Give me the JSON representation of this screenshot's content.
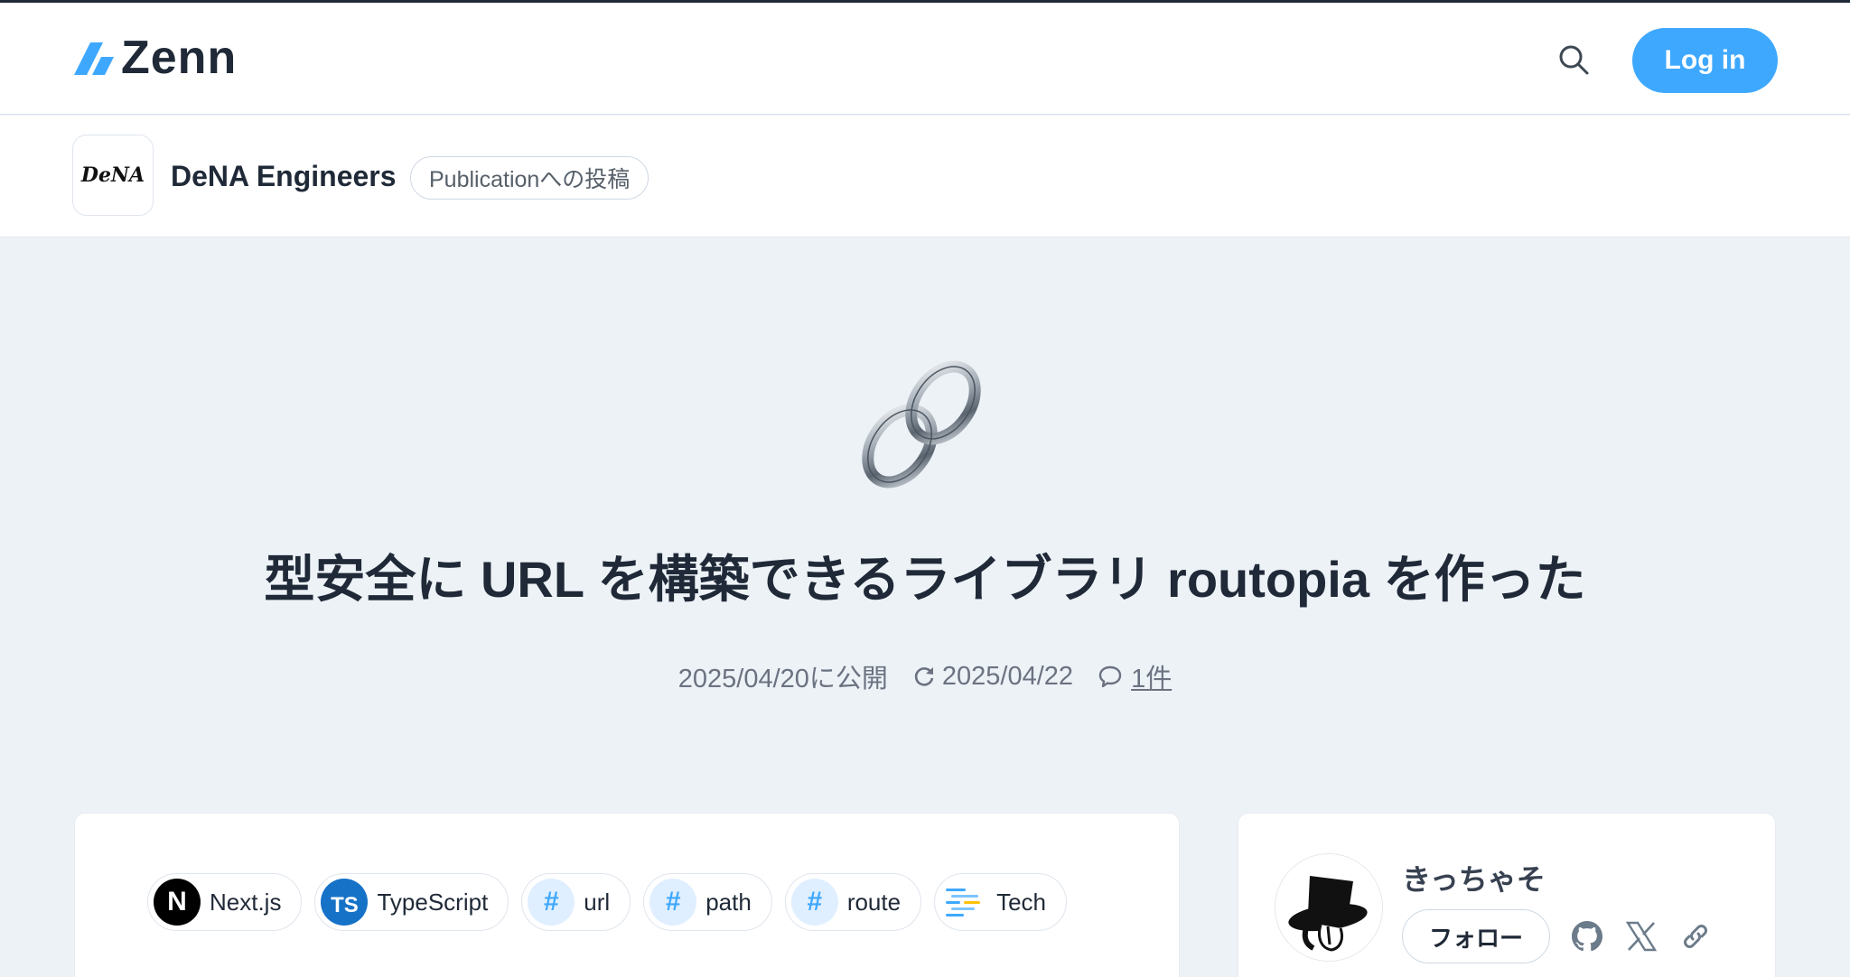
{
  "header": {
    "logo_text": "Zenn",
    "login_label": "Log in"
  },
  "publication": {
    "logo_text": "DeNA",
    "name": "DeNA Engineers",
    "tag": "Publicationへの投稿"
  },
  "article": {
    "emoji": "chain-link",
    "title": "型安全に URL を構築できるライブラリ routopia を作った",
    "published": "2025/04/20に公開",
    "updated": "2025/04/22",
    "comments": "1件"
  },
  "topics": [
    {
      "label": "Next.js",
      "icon": "nextjs-icon",
      "glyph": "N"
    },
    {
      "label": "TypeScript",
      "icon": "typescript-icon",
      "glyph": "TS"
    },
    {
      "label": "url",
      "icon": "hash-icon",
      "glyph": "#"
    },
    {
      "label": "path",
      "icon": "hash-icon",
      "glyph": "#"
    },
    {
      "label": "route",
      "icon": "hash-icon",
      "glyph": "#"
    },
    {
      "label": "Tech",
      "icon": "tech-icon",
      "glyph": ""
    }
  ],
  "author": {
    "name": "きっちゃそ",
    "follow_label": "フォロー",
    "socials": [
      "github-icon",
      "x-icon",
      "link-icon"
    ]
  },
  "colors": {
    "accent": "#3ea8ff",
    "background": "#edf2f7",
    "text": "#1f2937"
  }
}
